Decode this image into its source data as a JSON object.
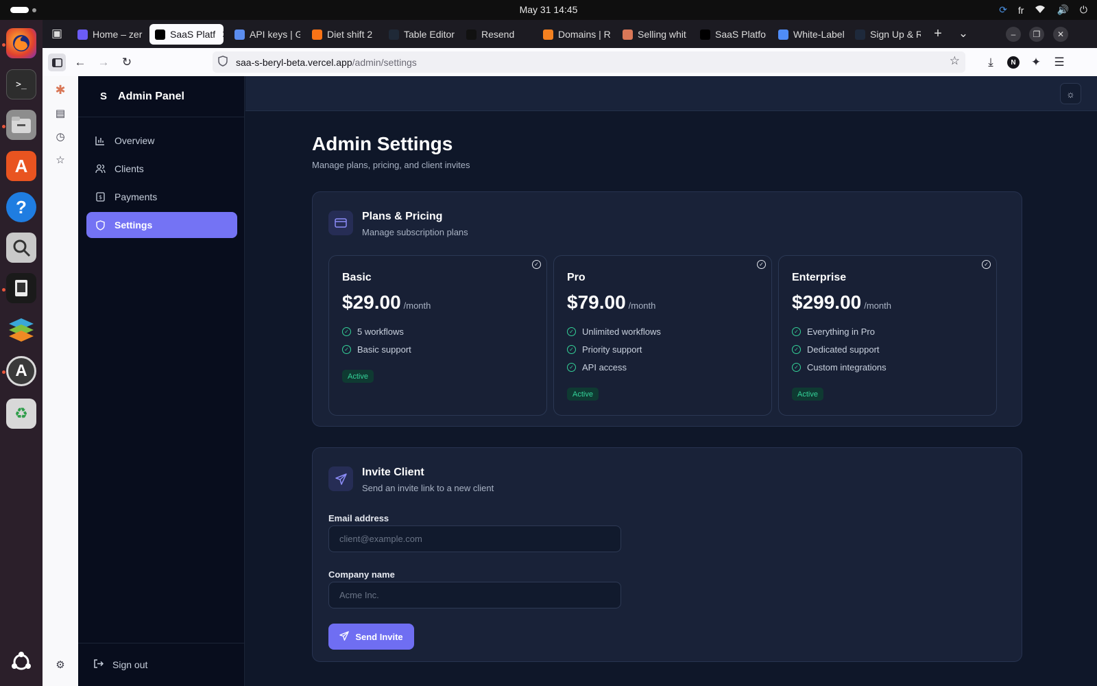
{
  "system": {
    "clock": "May 31  14:45",
    "language": "fr"
  },
  "dock": {
    "apps": [
      "firefox-icon",
      "terminal-icon",
      "files-icon",
      "app-center-icon",
      "help-icon",
      "image-viewer-icon",
      "window-icon",
      "layers-icon",
      "software-updater-icon",
      "trash-icon"
    ],
    "grid_icon": "show-apps-icon"
  },
  "browser": {
    "tabs": [
      {
        "label": "Home – zer",
        "icon": "purple-doc-icon",
        "color": "#6b5cf6"
      },
      {
        "label": "SaaS Platf",
        "icon": "vercel-icon",
        "color": "#000000",
        "active": true
      },
      {
        "label": "API keys | G",
        "icon": "stack-icon",
        "color": "#5b8def"
      },
      {
        "label": "Diet shift 2",
        "icon": "flame-icon",
        "color": "#f97316"
      },
      {
        "label": "Table Editor",
        "icon": "supabase-icon",
        "color": "#1f2937"
      },
      {
        "label": "Resend",
        "icon": "resend-icon",
        "color": "#111111"
      },
      {
        "label": "Domains | R",
        "icon": "cloud-icon",
        "color": "#f48120"
      },
      {
        "label": "Selling whit",
        "icon": "asterisk-icon",
        "color": "#d97757"
      },
      {
        "label": "SaaS Platfor",
        "icon": "vercel-icon",
        "color": "#000000"
      },
      {
        "label": "White-Label",
        "icon": "sparkle-icon",
        "color": "#4f8cf7"
      },
      {
        "label": "Sign Up & R",
        "icon": "letter-f-icon",
        "color": "#1e293b"
      }
    ],
    "url_host": "saa-s-beryl-beta.vercel.app",
    "url_path": "/admin/settings"
  },
  "app": {
    "brand_logo": "S",
    "brand_title": "Admin Panel",
    "nav": [
      {
        "label": "Overview",
        "icon": "chart-icon"
      },
      {
        "label": "Clients",
        "icon": "users-icon"
      },
      {
        "label": "Payments",
        "icon": "receipt-icon"
      },
      {
        "label": "Settings",
        "icon": "shield-icon",
        "active": true
      }
    ],
    "signout_label": "Sign out",
    "page_title": "Admin Settings",
    "page_subtitle": "Manage plans, pricing, and client invites",
    "plans_card": {
      "title": "Plans & Pricing",
      "subtitle": "Manage subscription plans"
    },
    "plans": [
      {
        "name": "Basic",
        "price": "$29.00",
        "period": "/month",
        "features": [
          "5 workflows",
          "Basic support"
        ],
        "status": "Active"
      },
      {
        "name": "Pro",
        "price": "$79.00",
        "period": "/month",
        "features": [
          "Unlimited workflows",
          "Priority support",
          "API access"
        ],
        "status": "Active"
      },
      {
        "name": "Enterprise",
        "price": "$299.00",
        "period": "/month",
        "features": [
          "Everything in Pro",
          "Dedicated support",
          "Custom integrations"
        ],
        "status": "Active"
      }
    ],
    "invite_card": {
      "title": "Invite Client",
      "subtitle": "Send an invite link to a new client",
      "email_label": "Email address",
      "email_placeholder": "client@example.com",
      "company_label": "Company name",
      "company_placeholder": "Acme Inc.",
      "send_label": "Send Invite"
    }
  }
}
